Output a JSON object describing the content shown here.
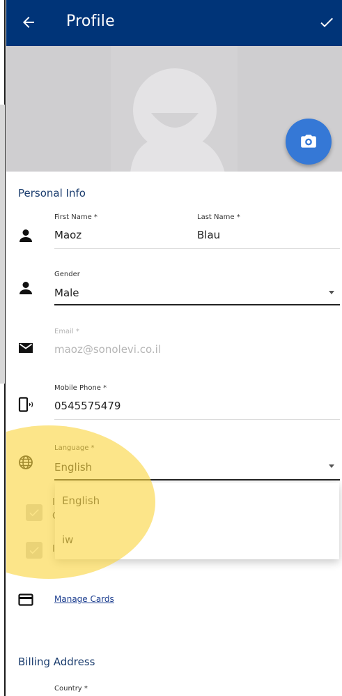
{
  "header": {
    "title": "Profile"
  },
  "personal_info": {
    "section_title": "Personal Info",
    "first_name": {
      "label": "First Name *",
      "value": "Maoz"
    },
    "last_name": {
      "label": "Last Name *",
      "value": "Blau"
    },
    "gender": {
      "label": "Gender",
      "value": "Male"
    },
    "email": {
      "label": "Email *",
      "value": "maoz@sonolevi.co.il"
    },
    "mobile_phone": {
      "label": "Mobile Phone *",
      "value": "0545575479"
    },
    "language": {
      "label": "Language *",
      "value": "English",
      "options": [
        "English",
        "iw"
      ]
    }
  },
  "checkboxes": [
    {
      "text": "I",
      "text2": "C"
    },
    {
      "text": "I"
    }
  ],
  "cards": {
    "link_label": "Manage Cards"
  },
  "billing": {
    "section_title": "Billing Address",
    "country": {
      "label": "Country *"
    }
  },
  "colors": {
    "header_bg": "#003478",
    "fab_bg": "#3578d6",
    "section_title": "#1b3d6e",
    "highlight": "#fad541"
  },
  "icons": {
    "back": "arrow-left-icon",
    "save": "check-icon",
    "camera": "camera-icon",
    "person": "person-icon",
    "email": "envelope-icon",
    "phone": "mobile-phone-icon",
    "language": "globe-icon",
    "card": "credit-card-icon",
    "dropdown": "caret-down-icon"
  }
}
